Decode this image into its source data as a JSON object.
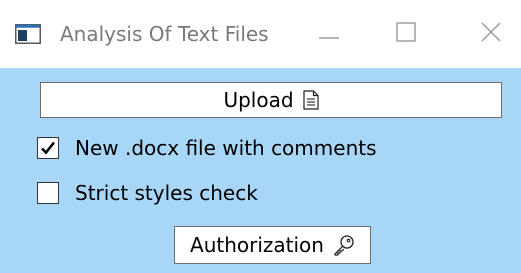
{
  "window": {
    "title": "Analysis Of Text Files",
    "controls": {
      "minimize_icon": "minimize-icon",
      "maximize_icon": "maximize-icon",
      "close_icon": "close-icon"
    }
  },
  "upload_button": {
    "label": "Upload",
    "icon": "document-icon"
  },
  "options": [
    {
      "label": "New .docx file with comments",
      "checked": true
    },
    {
      "label": "Strict styles check",
      "checked": false
    }
  ],
  "authorization_button": {
    "label": "Authorization",
    "icon": "key-icon"
  },
  "colors": {
    "client_background": "#a8d6f6",
    "title_text": "#7a7a7a"
  }
}
